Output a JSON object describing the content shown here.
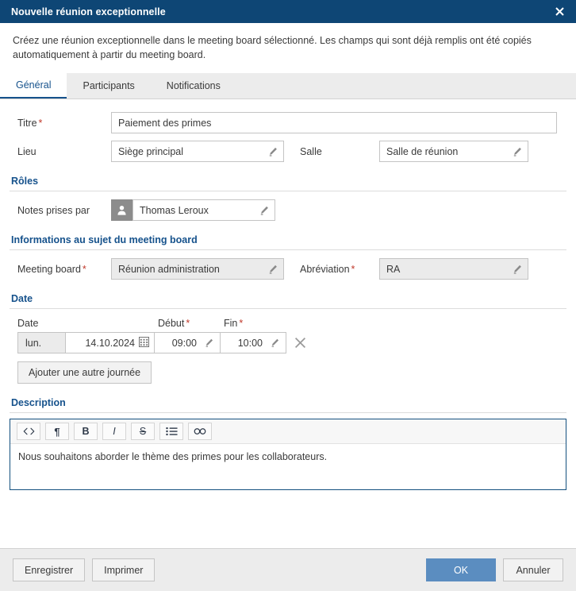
{
  "window": {
    "title": "Nouvelle réunion exceptionnelle",
    "close_icon": "close-icon",
    "accent_titlebar": "#0e4675",
    "accent_primary": "#5b8dc0",
    "accent_section": "#16528c",
    "required_marker": "#c0392b"
  },
  "intro": "Créez une réunion exceptionnelle dans le meeting board sélectionné. Les champs qui sont déjà remplis ont été copiés automatiquement à partir du meeting board.",
  "tabs": [
    {
      "label": "Général",
      "active": true
    },
    {
      "label": "Participants",
      "active": false
    },
    {
      "label": "Notifications",
      "active": false
    }
  ],
  "form": {
    "titre": {
      "label": "Titre",
      "required": "*",
      "value": "Paiement des primes"
    },
    "lieu": {
      "label": "Lieu",
      "value": "Siège principal",
      "icon": "pencil-icon"
    },
    "salle": {
      "label": "Salle",
      "value": "Salle de réunion",
      "icon": "pencil-icon"
    },
    "roles_header": "Rôles",
    "notes_prises_par": {
      "label": "Notes prises par",
      "value": "Thomas Leroux",
      "avatar_icon": "person-icon",
      "icon": "pencil-icon"
    },
    "board_header": "Informations au sujet du meeting board",
    "meeting_board": {
      "label": "Meeting board",
      "required": "*",
      "value": "Réunion administration",
      "icon": "pencil-icon"
    },
    "abreviation": {
      "label": "Abréviation",
      "required": "*",
      "value": "RA",
      "icon": "pencil-icon"
    },
    "date_header": "Date",
    "date_columns": {
      "date": "Date",
      "debut": "Début",
      "debut_required": "*",
      "fin": "Fin",
      "fin_required": "*"
    },
    "date_row": {
      "day": "lun.",
      "date": "14.10.2024",
      "calendar_icon": "calendar-icon",
      "debut": "09:00",
      "fin": "10:00",
      "clear_icon": "close-icon"
    },
    "add_day_button": "Ajouter une autre journée",
    "description_header": "Description",
    "description_toolbar": [
      {
        "name": "code-icon",
        "glyph": "<>"
      },
      {
        "name": "paragraph-icon",
        "glyph": "¶"
      },
      {
        "name": "bold-icon",
        "glyph": "B"
      },
      {
        "name": "italic-icon",
        "glyph": "I"
      },
      {
        "name": "strikethrough-icon",
        "glyph": "S"
      },
      {
        "name": "bullet-list-icon",
        "glyph": "☰"
      },
      {
        "name": "link-icon",
        "glyph": "∞"
      }
    ],
    "description_text": "Nous souhaitons aborder le thème des primes pour les collaborateurs."
  },
  "footer": {
    "save": "Enregistrer",
    "print": "Imprimer",
    "ok": "OK",
    "cancel": "Annuler"
  }
}
